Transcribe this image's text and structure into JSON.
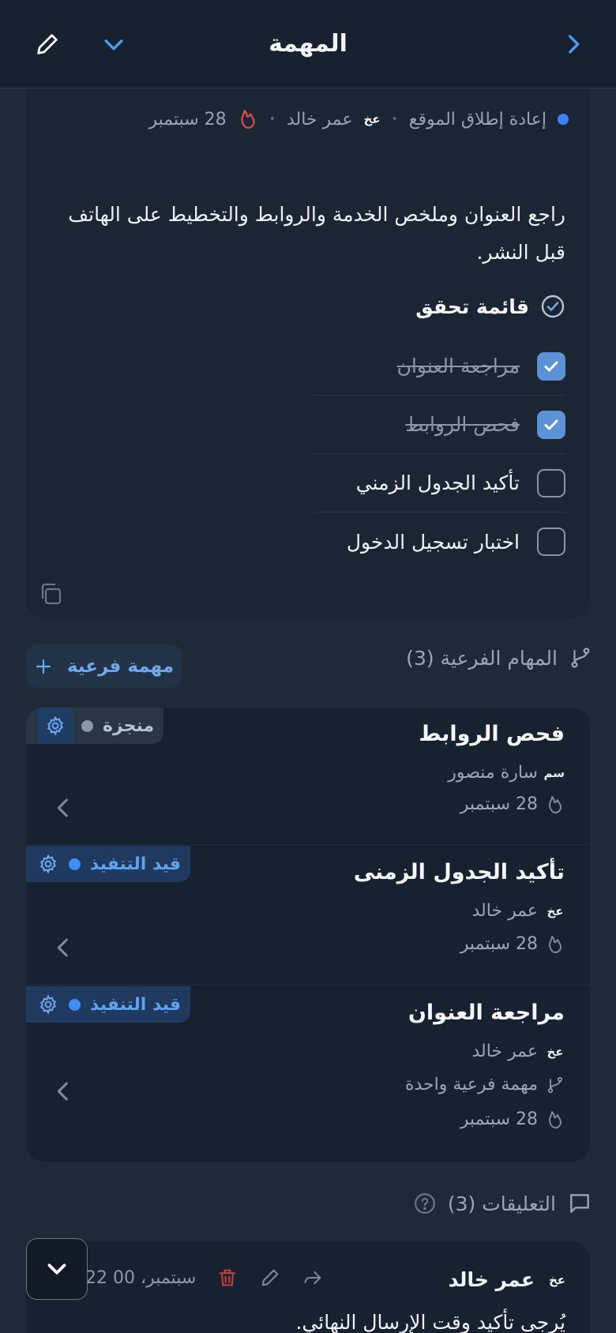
{
  "header": {
    "title": "المهمة"
  },
  "task": {
    "project": "إعادة إطلاق الموقع",
    "assignee_initials": "عخ",
    "assignee": "عمر خالد",
    "due": "28 سبتمبر",
    "description": "راجع العنوان وملخص الخدمة والروابط والتخطيط على الهاتف قبل النشر.",
    "checklist_title": "قائمة تحقق",
    "checklist": [
      {
        "label": "مراجعة العنوان",
        "done": true
      },
      {
        "label": "فحص الروابط",
        "done": true
      },
      {
        "label": "تأكيد الجدول الزمني",
        "done": false
      },
      {
        "label": "اختبار تسجيل الدخول",
        "done": false
      }
    ]
  },
  "subtasks": {
    "heading": "المهام الفرعية (3)",
    "add_label": "مهمة فرعية",
    "items": [
      {
        "title": "فحص الروابط",
        "status": "منجزة",
        "initials": "سم",
        "assignee": "سارة منصور",
        "due": "28 سبتمبر"
      },
      {
        "title": "تأكيد الجدول الزمنى",
        "status": "قيد التنفيذ",
        "initials": "عخ",
        "assignee": "عمر خالد",
        "due": "28 سبتمبر"
      },
      {
        "title": "مراجعة العنوان",
        "status": "قيد التنفيذ",
        "initials": "عخ",
        "assignee": "عمر خالد",
        "subcount": "مهمة فرعية واحدة",
        "due": "28 سبتمبر"
      }
    ]
  },
  "comments": {
    "heading": "التعليقات (3)",
    "first": {
      "initials": "عخ",
      "author": "عمر خالد",
      "date": "22 سبتمبر، 00",
      "text": "يُرجى تأكيد وقت الإرسال النهائي."
    }
  },
  "colors": {
    "accent": "#3b82f6",
    "danger": "#e5484d",
    "background": "#1f2938"
  }
}
